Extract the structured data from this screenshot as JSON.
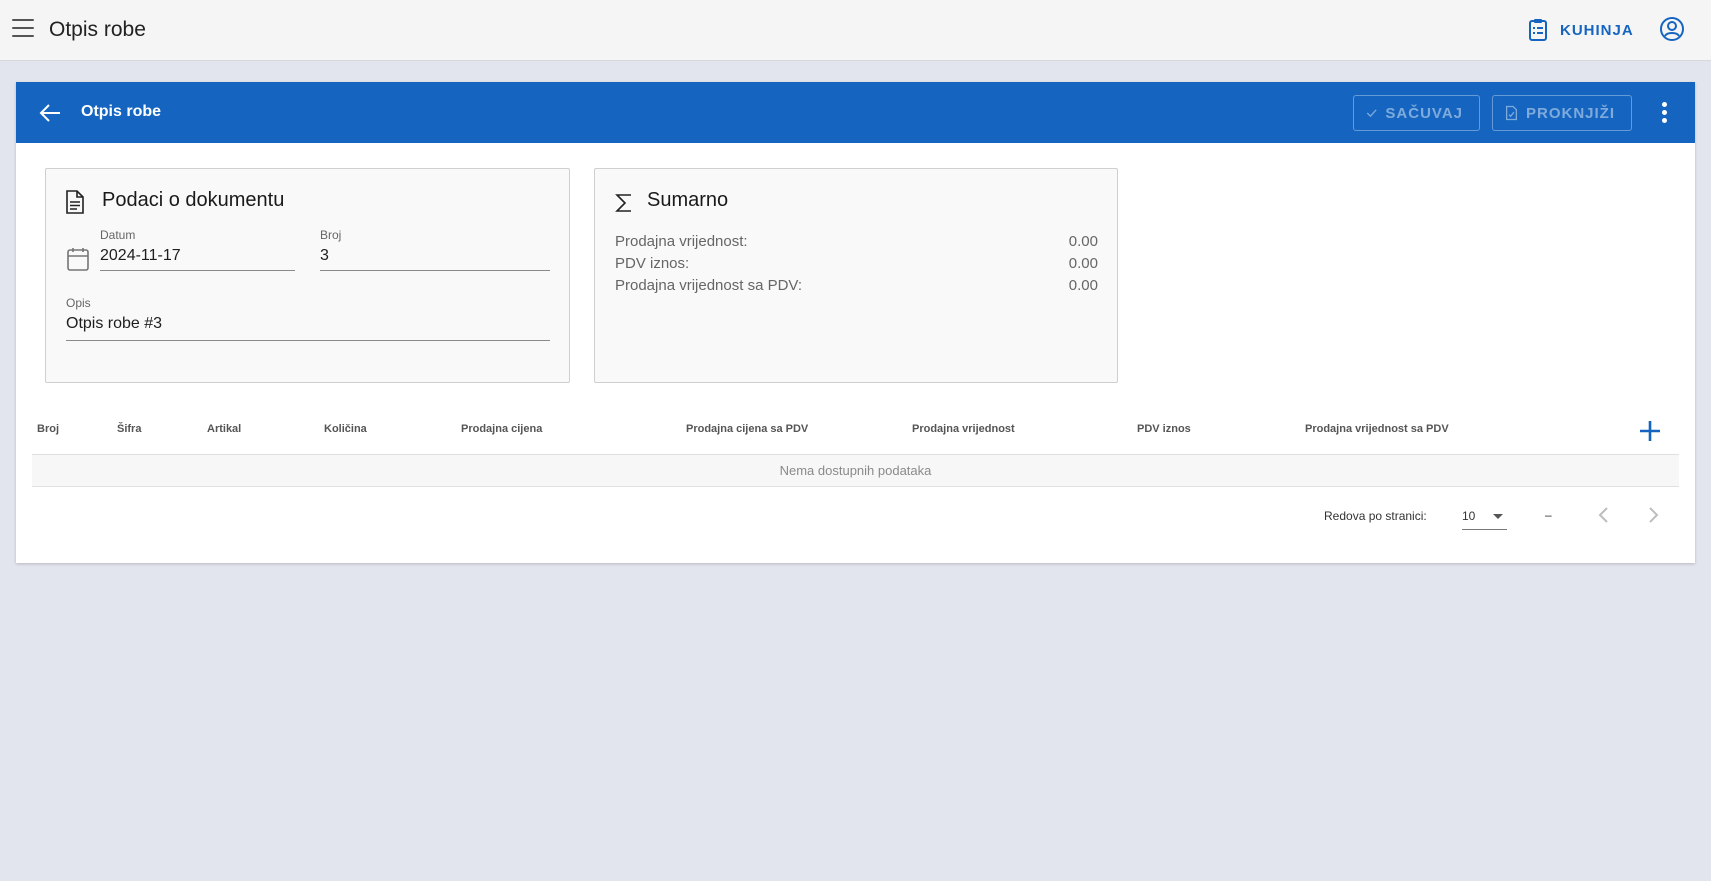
{
  "topbar": {
    "title": "Otpis robe",
    "kitchen_label": "KUHINJA",
    "icons": {
      "menu": "hamburger-menu-icon",
      "kitchen": "clipboard-list-icon",
      "account": "account-circle-icon"
    }
  },
  "card": {
    "title": "Otpis robe",
    "save_label": "SAČUVAJ",
    "post_label": "PROKNJIŽI",
    "colors": {
      "header": "#1565c0"
    }
  },
  "document_panel": {
    "title": "Podaci o dokumentu",
    "date_label": "Datum",
    "date_value": "2024-11-17",
    "number_label": "Broj",
    "number_value": "3",
    "description_label": "Opis",
    "description_value": "Otpis robe #3"
  },
  "summary_panel": {
    "title": "Sumarno",
    "rows": [
      {
        "label": "Prodajna vrijednost:",
        "value": "0.00"
      },
      {
        "label": "PDV iznos:",
        "value": "0.00"
      },
      {
        "label": "Prodajna vrijednost sa PDV:",
        "value": "0.00"
      }
    ]
  },
  "table": {
    "columns": [
      "Broj",
      "Šifra",
      "Artikal",
      "Količina",
      "Prodajna cijena",
      "Prodajna cijena sa PDV",
      "Prodajna vrijednost",
      "PDV iznos",
      "Prodajna vrijednost sa PDV"
    ],
    "empty_text": "Nema dostupnih podataka"
  },
  "pagination": {
    "rows_per_page_label": "Redova po stranici:",
    "rows_per_page_value": "10",
    "range_text": "–"
  }
}
